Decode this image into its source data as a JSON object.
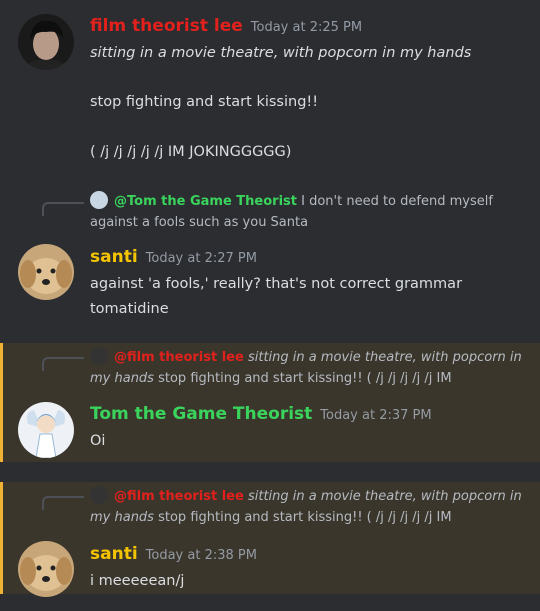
{
  "colors": {
    "lee": "#e2211c",
    "santi": "#f5c400",
    "tom": "#3ad35c",
    "mention_bar": "#f0b232"
  },
  "messages": {
    "m1": {
      "author": "film theorist lee",
      "time": "Today at 2:25 PM",
      "line1": "sitting in a movie theatre, with popcorn in my hands",
      "line2": "stop fighting and start kissing!!",
      "line3": "( /j /j /j /j /j IM JOKINGGGGG)"
    },
    "m2": {
      "reply_author": "@Tom the Game Theorist",
      "reply_line1": "I don't need to defend myself",
      "reply_line2": "against a fools such as you Santa",
      "author": "santi",
      "time": "Today at 2:27 PM",
      "line1": "against 'a fools,' really? that's not correct grammar",
      "line2": "tomatidine"
    },
    "m3": {
      "reply_author": "@film theorist lee",
      "reply_italic": "sitting in a movie theatre, with popcorn in",
      "reply_italic2": "my hands",
      "reply_rest": "stop fighting and start kissing!! ( /j /j /j /j /j IM",
      "author": "Tom the Game Theorist",
      "time": "Today at 2:37 PM",
      "line1": "Oi"
    },
    "m4": {
      "reply_author": "@film theorist lee",
      "reply_italic": "sitting in a movie theatre, with popcorn in",
      "reply_italic2": "my hands",
      "reply_rest": "stop fighting and start kissing!! ( /j /j /j /j /j IM",
      "author": "santi",
      "time": "Today at 2:38 PM",
      "line1": "i meeeeean/j"
    }
  }
}
